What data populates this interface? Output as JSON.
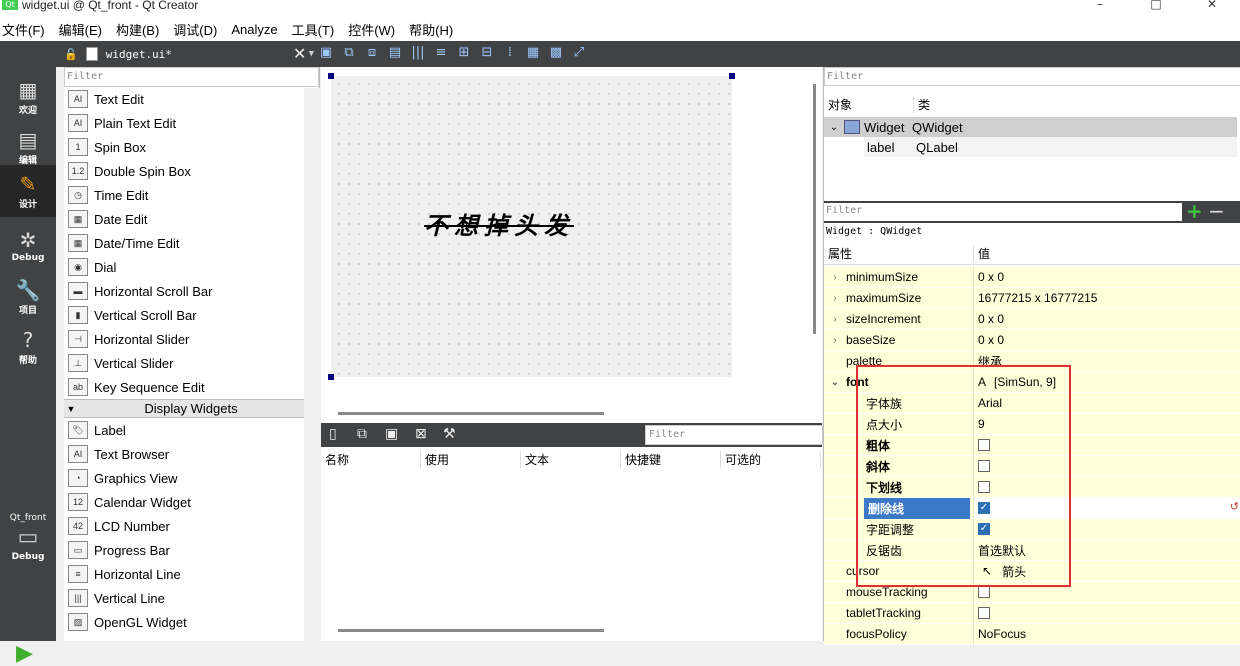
{
  "window": {
    "title": "widget.ui @ Qt_front - Qt Creator",
    "buttons": [
      "–",
      "□",
      "✕"
    ]
  },
  "menu": [
    "文件(F)",
    "编辑(E)",
    "构建(B)",
    "调试(D)",
    "Analyze",
    "工具(T)",
    "控件(W)",
    "帮助(H)"
  ],
  "modes": [
    {
      "label": "欢迎",
      "icon": "▦"
    },
    {
      "label": "编辑",
      "icon": "▤"
    },
    {
      "label": "设计",
      "icon": "✎"
    },
    {
      "label": "Debug",
      "icon": "✲"
    },
    {
      "label": "项目",
      "icon": "🔧"
    },
    {
      "label": "帮助",
      "icon": "?"
    }
  ],
  "kit": {
    "name": "Qt_front",
    "label": "Debug"
  },
  "editor": {
    "filename": "widget.ui*"
  },
  "widgetbox": {
    "filter_placeholder": "Filter",
    "items": [
      {
        "label": "Text Edit",
        "icon": "AI"
      },
      {
        "label": "Plain Text Edit",
        "icon": "AI"
      },
      {
        "label": "Spin Box",
        "icon": "1"
      },
      {
        "label": "Double Spin Box",
        "icon": "1.2"
      },
      {
        "label": "Time Edit",
        "icon": "◷"
      },
      {
        "label": "Date Edit",
        "icon": "▦"
      },
      {
        "label": "Date/Time Edit",
        "icon": "▦"
      },
      {
        "label": "Dial",
        "icon": "◉"
      },
      {
        "label": "Horizontal Scroll Bar",
        "icon": "▬"
      },
      {
        "label": "Vertical Scroll Bar",
        "icon": "▮"
      },
      {
        "label": "Horizontal Slider",
        "icon": "⊣"
      },
      {
        "label": "Vertical Slider",
        "icon": "⊥"
      },
      {
        "label": "Key Sequence Edit",
        "icon": "ab"
      }
    ],
    "category": "Display Widgets",
    "display_items": [
      {
        "label": "Label",
        "icon": "🏷"
      },
      {
        "label": "Text Browser",
        "icon": "AI"
      },
      {
        "label": "Graphics View",
        "icon": "◔"
      },
      {
        "label": "Calendar Widget",
        "icon": "12"
      },
      {
        "label": "LCD Number",
        "icon": "42"
      },
      {
        "label": "Progress Bar",
        "icon": "▭"
      },
      {
        "label": "Horizontal Line",
        "icon": "≡"
      },
      {
        "label": "Vertical Line",
        "icon": "|||"
      },
      {
        "label": "OpenGL Widget",
        "icon": "▨"
      }
    ]
  },
  "form": {
    "label_text": "不想掉头发"
  },
  "actions": {
    "filter_placeholder": "Filter",
    "columns": [
      "名称",
      "使用",
      "文本",
      "快捷键",
      "可选的"
    ]
  },
  "objects": {
    "filter_placeholder": "Filter",
    "col_object": "对象",
    "col_class": "类",
    "rows": [
      {
        "name": "Widget",
        "class": "QWidget"
      },
      {
        "name": "label",
        "class": "QLabel"
      }
    ]
  },
  "properties": {
    "filter_placeholder": "Filter",
    "class_line": "Widget : QWidget",
    "col_property": "属性",
    "col_value": "值",
    "rows": [
      {
        "name": "minimumSize",
        "value": "0 x 0",
        "expand": "›"
      },
      {
        "name": "maximumSize",
        "value": "16777215 x 16777215",
        "expand": "›"
      },
      {
        "name": "sizeIncrement",
        "value": "0 x 0",
        "expand": "›"
      },
      {
        "name": "baseSize",
        "value": "0 x 0",
        "expand": "›"
      },
      {
        "name": "palette",
        "value": "继承",
        "expand": ""
      },
      {
        "name": "font",
        "value": "[SimSun, 9]",
        "expand": "⌄"
      },
      {
        "name": "字体族",
        "value": "Arial",
        "sub": true
      },
      {
        "name": "点大小",
        "value": "9",
        "sub": true
      },
      {
        "name": "粗体",
        "check": false,
        "sub": true
      },
      {
        "name": "斜体",
        "check": false,
        "sub": true
      },
      {
        "name": "下划线",
        "check": false,
        "sub": true
      },
      {
        "name": "删除线",
        "check": true,
        "sub": true
      },
      {
        "name": "字距调整",
        "check": true,
        "sub": true
      },
      {
        "name": "反锯齿",
        "value": "首选默认",
        "sub": true
      },
      {
        "name": "cursor",
        "value": "箭头",
        "expand": ""
      },
      {
        "name": "mouseTracking",
        "check": false,
        "expand": ""
      },
      {
        "name": "tabletTracking",
        "check": false,
        "expand": ""
      },
      {
        "name": "focusPolicy",
        "value": "NoFocus",
        "expand": ""
      }
    ]
  }
}
